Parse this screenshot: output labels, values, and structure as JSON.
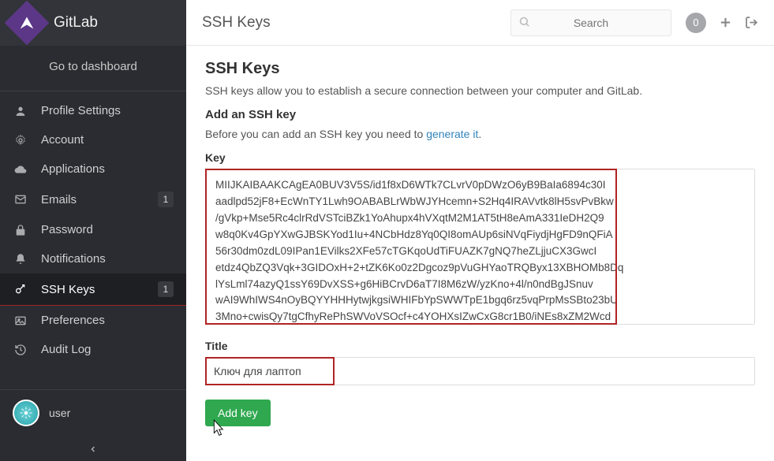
{
  "brand": {
    "name": "GitLab"
  },
  "sidebar": {
    "dashboard_link": "Go to dashboard",
    "items": [
      {
        "label": "Profile Settings",
        "icon": "user-icon"
      },
      {
        "label": "Account",
        "icon": "gear-icon"
      },
      {
        "label": "Applications",
        "icon": "cloud-icon"
      },
      {
        "label": "Emails",
        "icon": "envelope-icon",
        "badge": "1"
      },
      {
        "label": "Password",
        "icon": "lock-icon"
      },
      {
        "label": "Notifications",
        "icon": "bell-icon"
      },
      {
        "label": "SSH Keys",
        "icon": "key-icon",
        "badge": "1",
        "active": true
      },
      {
        "label": "Preferences",
        "icon": "image-icon"
      },
      {
        "label": "Audit Log",
        "icon": "history-icon"
      }
    ],
    "user": {
      "name": "user"
    }
  },
  "topbar": {
    "title": "SSH Keys",
    "search_placeholder": "Search",
    "badge_count": "0"
  },
  "page": {
    "heading": "SSH Keys",
    "description": "SSH keys allow you to establish a secure connection between your computer and GitLab.",
    "add_heading": "Add an SSH key",
    "hint_prefix": "Before you can add an SSH key you need to ",
    "hint_link": "generate it",
    "hint_suffix": ".",
    "key_label": "Key",
    "key_value": "MIIJKAIBAAKCAgEA0BUV3V5S/id1f8xD6WTk7CLvrV0pDWzO6yB9BaIa6894c30I\naadlpd52jF8+EcWnTY1Lwh9OABABLrWbWJYHcemn+S2Hq4IRAVvtk8lH5svPvBkw\n/gVkp+Mse5Rc4clrRdVSTciBZk1YoAhupx4hVXqtM2M1AT5tH8eAmA331IeDH2Q9\nw8q0Kv4GpYXwGJBSKYod1Iu+4NCbHdz8Yq0QI8omAUp6siNVqFiydjHgFD9nQFiA\n56r30dm0zdL09IPan1EVilks2XFe57cTGKqoUdTiFUAZK7gNQ7heZLjjuCX3GwcI\netdz4QbZQ3Vqk+3GIDOxH+2+tZK6Ko0z2Dgcoz9pVuGHYaoTRQByx13XBHOMb8Dq\nlYsLml74azyQ1ssY69DvXSS+g6HiBCrvD6aT7I8M6zW/yzKno+4l/n0ndBgJSnuv\nwAI9WhIWS4nOyBQYYHHHytwjkgsiWHIFbYpSWWTpE1bgq6rz5vqPrpMsSBto23bU\n3Mno+cwisQy7tgCfhyRePhSWVoVSOcf+c4YOHXsIZwCxG8cr1B0/iNEs8xZM2Wcd",
    "title_label": "Title",
    "title_value": "Ключ для лаптоп",
    "submit_label": "Add key"
  }
}
